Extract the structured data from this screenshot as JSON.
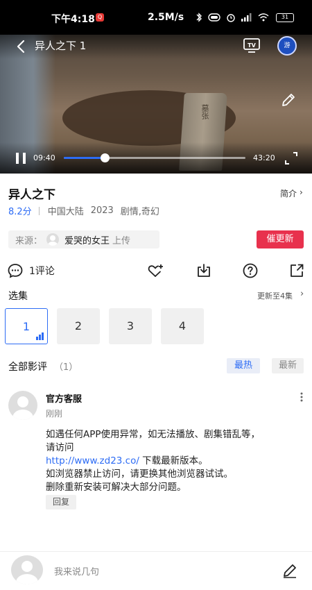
{
  "status_bar": {
    "time": "下午4:18",
    "notify_badge": "Q",
    "net_speed": "2.5M/s",
    "battery": "31"
  },
  "player": {
    "title": "异人之下 1",
    "avatar_text": "游",
    "current_time": "09:40",
    "duration": "43:20",
    "progress": 0.2235,
    "stone_text": "墓张"
  },
  "show": {
    "title": "异人之下",
    "intro_label": "简介",
    "rating": "8.2分",
    "region": "中国大陆",
    "year": "2023",
    "genres": "剧情,奇幻"
  },
  "source": {
    "label": "来源：",
    "uploader": "爱哭的女王",
    "upload_text": "上传",
    "urge_button": "催更新"
  },
  "actions": {
    "comment_count": "1评论"
  },
  "episodes": {
    "section_title": "选集",
    "update_text": "更新至4集",
    "items": [
      {
        "label": "1",
        "active": true
      },
      {
        "label": "2",
        "active": false
      },
      {
        "label": "3",
        "active": false
      },
      {
        "label": "4",
        "active": false
      }
    ]
  },
  "reviews": {
    "section_title": "全部影评",
    "count": "（1）",
    "sort_hot": "最热",
    "sort_new": "最新"
  },
  "comment": {
    "author": "官方客服",
    "time": "刚刚",
    "line1": "如遇任何APP使用异常，如无法播放、剧集错乱等，",
    "line2": "请访问",
    "link": "http://www.zd23.co/",
    "line3_suffix": " 下载最新版本。",
    "line4": "如浏览器禁止访问，请更换其他浏览器试试。",
    "line5": "删除重新安装可解决大部分问题。",
    "reply_label": "回复"
  },
  "input": {
    "placeholder": "我来说几句"
  },
  "colors": {
    "accent": "#2d6cf5",
    "urge": "#e8314d"
  }
}
